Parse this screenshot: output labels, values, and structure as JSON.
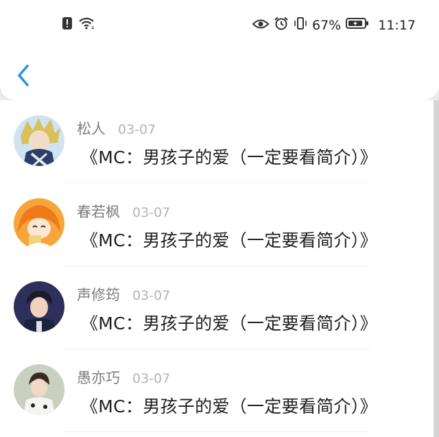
{
  "status_bar": {
    "battery_percent": "67%",
    "time": "11:17",
    "icons": [
      "alert-icon",
      "wifi-icon",
      "eye-icon",
      "alarm-icon",
      "vibrate-icon",
      "battery-icon"
    ]
  },
  "nav": {
    "back_icon": "chevron-left-icon"
  },
  "comments": [
    {
      "name": "松人",
      "date": "03-07",
      "title": "《MC：男孩子的爱（一定要看简介）》",
      "avatar_bg": "#6ea7d8"
    },
    {
      "name": "春若枫",
      "date": "03-07",
      "title": "《MC：男孩子的爱（一定要看简介）》",
      "avatar_bg": "#f59a2a"
    },
    {
      "name": "声修筠",
      "date": "03-07",
      "title": "《MC：男孩子的爱（一定要看简介）》",
      "avatar_bg": "#2d2f5c"
    },
    {
      "name": "愚亦巧",
      "date": "03-07",
      "title": "《MC：男孩子的爱（一定要看简介）》",
      "avatar_bg": "#c9d0c0"
    }
  ],
  "colors": {
    "accent": "#2f8fe6",
    "name_text": "#7d7d7d",
    "date_text": "#b4b4b4"
  }
}
